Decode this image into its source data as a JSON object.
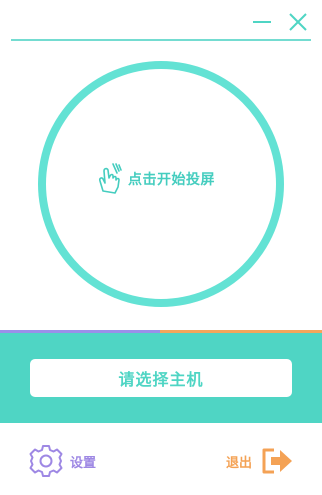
{
  "titlebar": {
    "minimize_icon": "minimize-icon",
    "close_icon": "close-icon"
  },
  "main": {
    "start_label": "点击开始投屏",
    "hand_icon": "hand-pointer-icon"
  },
  "panel": {
    "select_host_label": "请选择主机"
  },
  "footer": {
    "settings_label": "设置",
    "settings_icon": "gear-icon",
    "logout_label": "退出",
    "logout_icon": "exit-icon"
  },
  "colors": {
    "teal": "#4fd5c4",
    "ring": "#63e2d4",
    "purple": "#9b8fe9",
    "orange": "#f5a65b"
  }
}
